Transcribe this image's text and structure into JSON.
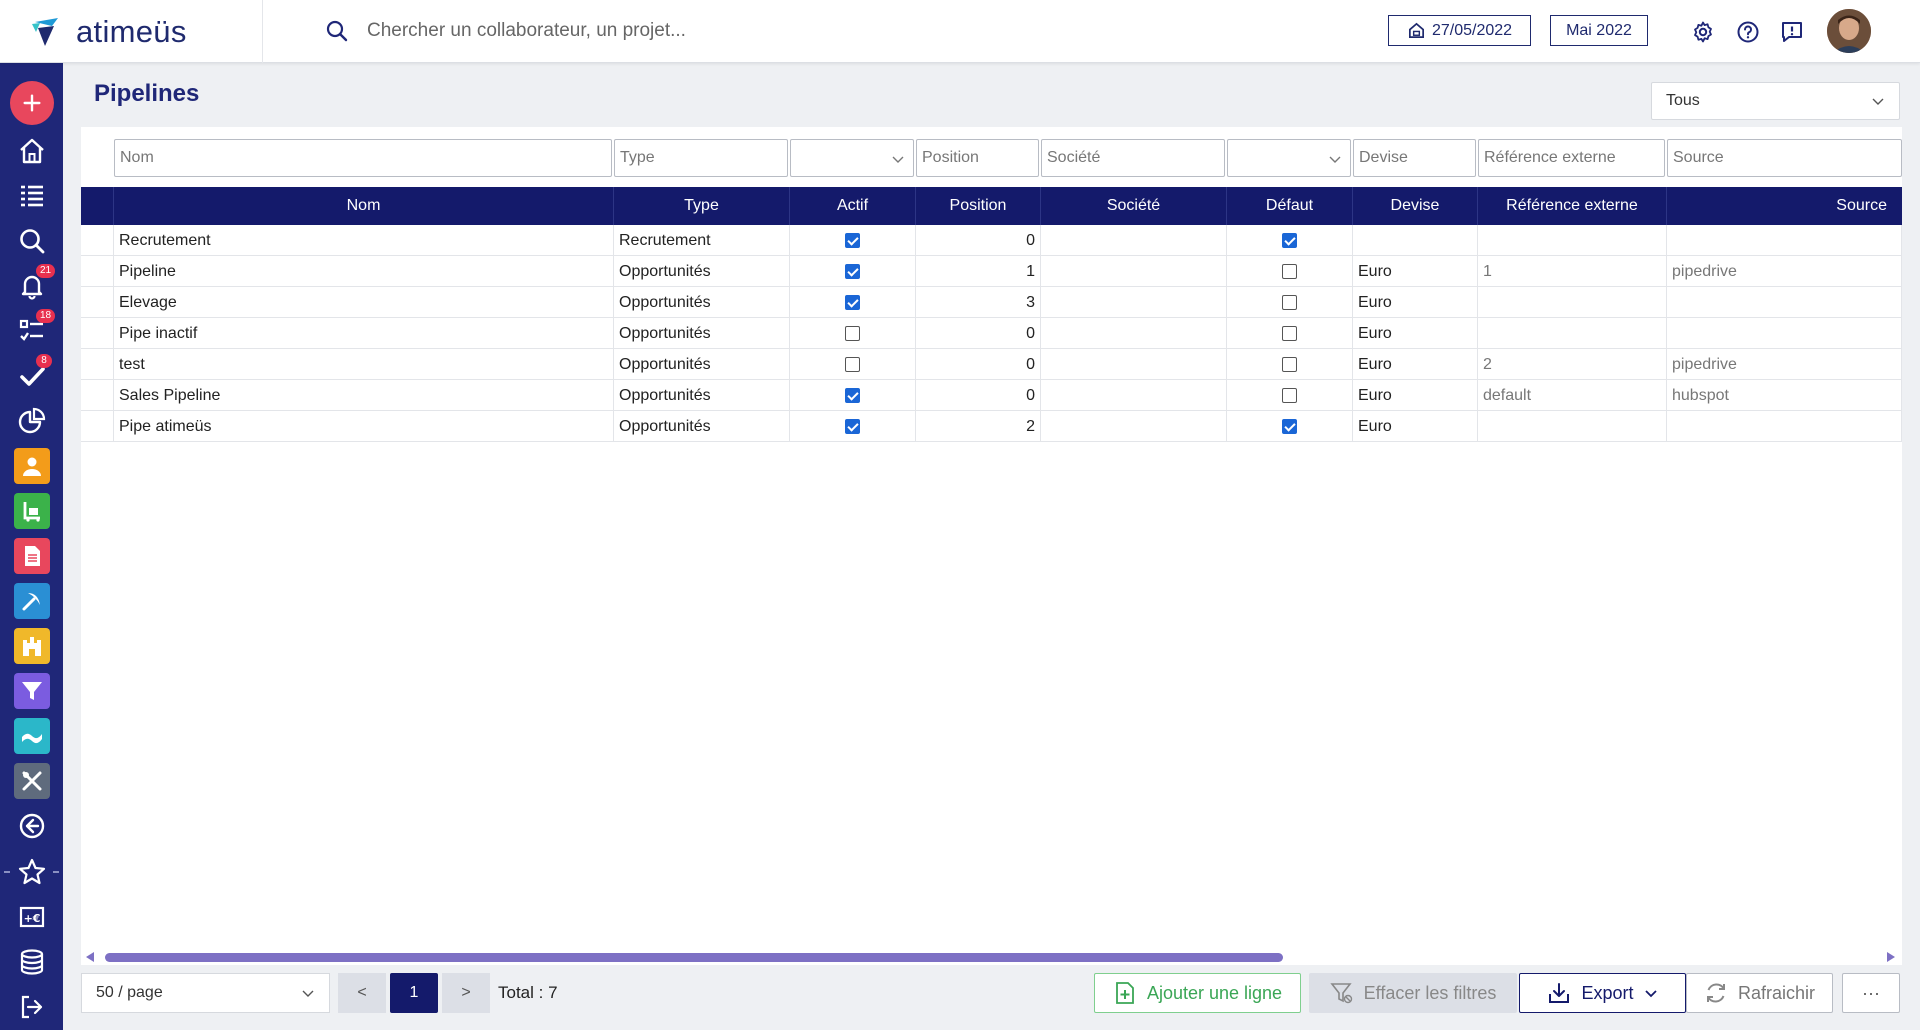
{
  "brand": {
    "name": "atimeüs"
  },
  "search": {
    "placeholder": "Chercher un collaborateur, un projet..."
  },
  "header": {
    "date": "27/05/2022",
    "period": "Mai 2022"
  },
  "sidebar": {
    "badges": {
      "notifications": "21",
      "tasks": "18",
      "validations": "8"
    }
  },
  "page": {
    "title": "Pipelines",
    "scope_filter": "Tous"
  },
  "filters": {
    "nom": "Nom",
    "type": "Type",
    "position": "Position",
    "societe": "Société",
    "devise": "Devise",
    "reference": "Référence externe",
    "source": "Source"
  },
  "columns": [
    "Nom",
    "Type",
    "Actif",
    "Position",
    "Société",
    "Défaut",
    "Devise",
    "Référence externe",
    "Source"
  ],
  "rows": [
    {
      "nom": "Recrutement",
      "type": "Recrutement",
      "actif": true,
      "position": "0",
      "societe": "",
      "defaut": true,
      "devise": "",
      "reference": "",
      "source": ""
    },
    {
      "nom": "Pipeline",
      "type": "Opportunités",
      "actif": true,
      "position": "1",
      "societe": "",
      "defaut": false,
      "devise": "Euro",
      "reference": "1",
      "source": "pipedrive"
    },
    {
      "nom": "Elevage",
      "type": "Opportunités",
      "actif": true,
      "position": "3",
      "societe": "",
      "defaut": false,
      "devise": "Euro",
      "reference": "",
      "source": ""
    },
    {
      "nom": "Pipe inactif",
      "type": "Opportunités",
      "actif": false,
      "position": "0",
      "societe": "",
      "defaut": false,
      "devise": "Euro",
      "reference": "",
      "source": ""
    },
    {
      "nom": "test",
      "type": "Opportunités",
      "actif": false,
      "position": "0",
      "societe": "",
      "defaut": false,
      "devise": "Euro",
      "reference": "2",
      "source": "pipedrive"
    },
    {
      "nom": "Sales Pipeline",
      "type": "Opportunités",
      "actif": true,
      "position": "0",
      "societe": "",
      "defaut": false,
      "devise": "Euro",
      "reference": "default",
      "source": "hubspot"
    },
    {
      "nom": "Pipe atimeüs",
      "type": "Opportunités",
      "actif": true,
      "position": "2",
      "societe": "",
      "defaut": true,
      "devise": "Euro",
      "reference": "",
      "source": ""
    }
  ],
  "pagination": {
    "per_page": "50 / page",
    "prev": "<",
    "current": "1",
    "next": ">",
    "total": "Total : 7"
  },
  "actions": {
    "add_row": "Ajouter une ligne",
    "clear_filters": "Effacer les filtres",
    "export": "Export",
    "refresh": "Rafraichir",
    "more": "···"
  },
  "colors": {
    "navy": "#1f2778",
    "header": "#141a6b",
    "accent_red": "#e8475d",
    "check_blue": "#1a66d6",
    "add_green": "#3aa655"
  }
}
